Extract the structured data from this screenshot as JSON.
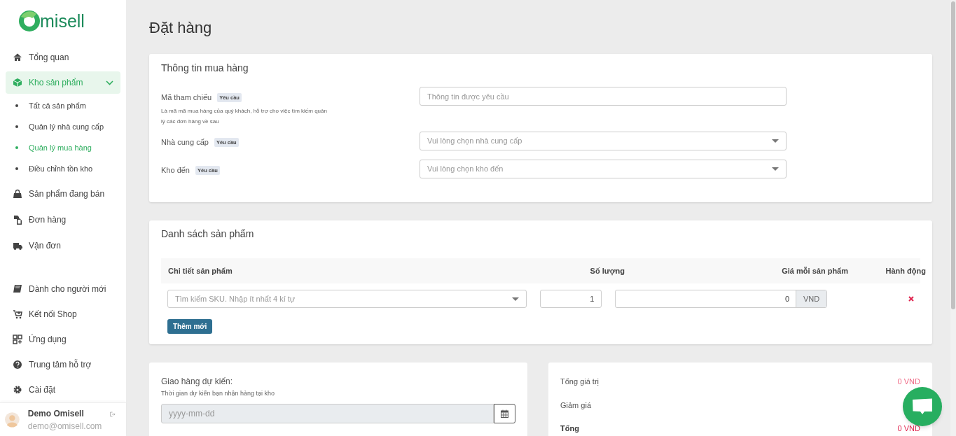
{
  "logo": {
    "text": "misell"
  },
  "sidebar": {
    "items": [
      {
        "kind": "item",
        "label": "Tổng quan",
        "selected": false
      },
      {
        "kind": "item",
        "label": "Kho sản phẩm",
        "selected": true,
        "expanded": true
      },
      {
        "kind": "sub",
        "label": "Tất cả sản phẩm",
        "selected": false
      },
      {
        "kind": "sub",
        "label": "Quản lý nhà cung cấp",
        "selected": false
      },
      {
        "kind": "sub",
        "label": "Quản lý mua hàng",
        "selected": true
      },
      {
        "kind": "sub",
        "label": "Điều chỉnh tồn kho",
        "selected": false
      },
      {
        "kind": "item",
        "label": "Sản phẩm đang bán",
        "selected": false
      },
      {
        "kind": "item",
        "label": "Đơn hàng",
        "selected": false
      },
      {
        "kind": "item",
        "label": "Vận đơn",
        "selected": false
      },
      {
        "kind": "gap"
      },
      {
        "kind": "item",
        "label": "Dành cho người mới",
        "selected": false
      },
      {
        "kind": "item",
        "label": "Kết nối Shop",
        "selected": false
      },
      {
        "kind": "item",
        "label": "Ứng dụng",
        "selected": false
      },
      {
        "kind": "item",
        "label": "Trung tâm hỗ trợ",
        "selected": false
      },
      {
        "kind": "item",
        "label": "Cài đặt",
        "selected": false
      }
    ]
  },
  "user": {
    "name": "Demo Omisell",
    "email": "demo@omisell.com"
  },
  "page_title": "Đặt hàng",
  "purchase_info": {
    "title": "Thông tin mua hàng",
    "fields": [
      {
        "kind": "text",
        "label": "Mã tham chiếu",
        "badge": "Yêu cầu",
        "help": "Là mã mã mua hàng của quý khách, hỗ trợ cho việc tìm kiếm quản lý các đơn hàng về sau",
        "placeholder": "Thông tin được yêu cầu"
      },
      {
        "kind": "select",
        "label": "Nhà cung cấp",
        "badge": "Yêu cầu",
        "placeholder": "Vui lòng chọn nhà cung cấp"
      },
      {
        "kind": "select",
        "label": "Kho đến",
        "badge": "Yêu cầu",
        "placeholder": "Vui lòng chọn kho đến"
      }
    ]
  },
  "products": {
    "title": "Danh sách sản phẩm",
    "columns": [
      "Chi tiết sản phẩm",
      "Số lượng",
      "Giá mỗi sản phẩm",
      "Hành động"
    ],
    "rows": [
      {
        "search_placeholder": "Tìm kiếm SKU. Nhập ít nhất 4 kí tự",
        "quantity": "1",
        "price": "0",
        "currency": "VND"
      }
    ],
    "add_button": "Thêm mới"
  },
  "delivery": {
    "label": "Giao hàng dự kiến:",
    "help": "Thời gian dự kiến bạn nhận hàng tại kho",
    "placeholder": "yyyy-mm-dd"
  },
  "summary": [
    {
      "label": "Tổng giá trị",
      "value": "0 VND",
      "bold": false
    },
    {
      "label": "Giảm giá",
      "bold": false
    },
    {
      "label": "Tổng",
      "value": "0 VND",
      "bold": true
    }
  ]
}
